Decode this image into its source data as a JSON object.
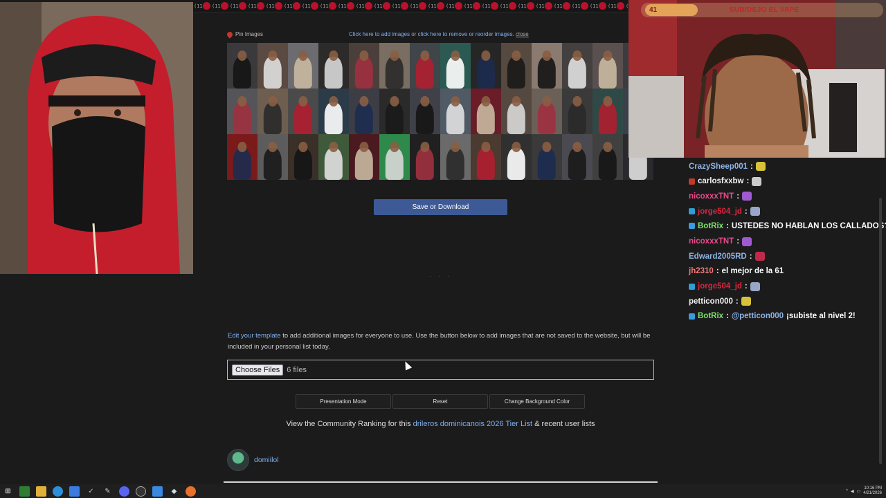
{
  "pin_bar": {
    "pin_label": "Pin Images",
    "add_link": "Click here to add images",
    "or": "or",
    "remove_link": "click here to remove or reorder images.",
    "close": "close"
  },
  "topstrip_label": "(11",
  "save_button": "Save or Download",
  "loading_dots": ". . .",
  "edit": {
    "link": "Edit your template",
    "text": "to add additional images for everyone to use. Use the button below to add images that are not saved to the website, but will be included in your personal list today."
  },
  "file_input": {
    "button": "Choose Files",
    "status": "6 files"
  },
  "buttons": {
    "presentation": "Presentation Mode",
    "reset": "Reset",
    "bg_color": "Change Background Color"
  },
  "community": {
    "prefix": "View the Community Ranking for this",
    "link": "drileros dominicanois 2026 Tier List",
    "suffix": "& recent user lists"
  },
  "author": {
    "name": "domiilol"
  },
  "stream_overlay": {
    "count": "41",
    "banner": "SUB/DEJO EL VAPE"
  },
  "chat": [
    {
      "user": "CrazySheep001",
      "color": "#8fb4e6",
      "text": "",
      "emote": "#d8c23a",
      "badge": ""
    },
    {
      "user": "carlosfxxbw",
      "color": "#f1f1f1",
      "text": "",
      "emote": "#cccccc",
      "badge": "#c0392b"
    },
    {
      "user": "nicoxxxTNT",
      "color": "#e84a8a",
      "text": "",
      "emote": "#a05ad0",
      "badge": ""
    },
    {
      "user": "jorge504_jd",
      "color": "#d9263f",
      "text": "",
      "emote": "#9aa6c8",
      "badge": "#2e9ed6"
    },
    {
      "user": "BotRix",
      "color": "#7ee36a",
      "text": "USTEDES NO HABLAN LOS CALLADOS?",
      "emote": "",
      "badge": "#3a9ae0"
    },
    {
      "user": "nicoxxxTNT",
      "color": "#e84a8a",
      "text": "",
      "emote": "#a05ad0",
      "badge": ""
    },
    {
      "user": "Edward2005RD",
      "color": "#8fb4e6",
      "text": "",
      "emote": "#c02a4a",
      "badge": ""
    },
    {
      "user": "jh2310",
      "color": "#f07a7a",
      "text": "el mejor de la 61",
      "emote": "",
      "badge": ""
    },
    {
      "user": "jorge504_jd",
      "color": "#d9263f",
      "text": "",
      "emote": "#9aa6c8",
      "badge": "#2e9ed6"
    },
    {
      "user": "petticon000",
      "color": "#f1f1f1",
      "text": "",
      "emote": "#d8c23a",
      "badge": ""
    },
    {
      "user": "BotRix",
      "color": "#7ee36a",
      "text": "¡subiste al nivel 2!",
      "mention": "@petticon000",
      "emote": "",
      "badge": "#3a9ae0"
    }
  ],
  "tray": {
    "time": "10:16 PM",
    "date": "4/21/2026"
  }
}
